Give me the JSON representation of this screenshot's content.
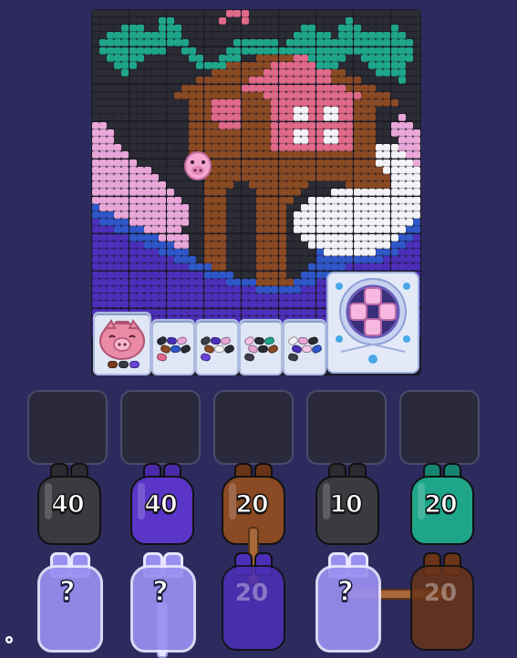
{
  "game": {
    "palette": {
      "K": "#2b2b34",
      "k": "#3d3d49",
      "T": "#1fa68a",
      "t": "#2cc2a2",
      "P": "#e8a7d8",
      "p": "#f6c4ea",
      "B": "#8a4a24",
      "b": "#a85e2e",
      "R": "#e06a8a",
      "W": "#f3f3f7",
      "V": "#4c2fb8",
      "v": "#6a45d8",
      "U": "#2f57c8",
      "D": "#3a2a1f"
    },
    "mosaic_rows": [
      "KKKKKKKKKKKKKKKKKKRRRKKKKKKKKKKKKKKKKKKKKKKK",
      "KKKKKKKKKTTKKKKKKRKKRKKKKKKKKKKKKKTKKKKKKKKK",
      "KKKKTTTKKTTTKKKKKKKKKKKKKKKKTTKKKTTTKKKKTKKK",
      "KKTTTTTTTTTTKKKKKKKKKKKKKKKTTTTTKTTTTTTTTTKK",
      "KTTTTTTTTTTTTKKKKKKTTTTTTKTTTTTTTTTTTTTTTTTK",
      "KTTTTTTTTTKKTTKKKKTTTTTTTTTTTTTTTTTTTTTTTTTK",
      "KKTTTTTKKKKKKTTKKTTTKKBBBBBRRTTTTTKKTTTTTTTK",
      "KKKTTTKKKKKKKKTTTTBBBBBBRRRRRRTTTKKKKTTTTTKK",
      "KKKKTKKKKKKKKKKKBBBBBBBRRRRRRRRRBBKKKKTTTTKK",
      "KKKKKKKKKKKKKKBBBBBBBRRRRRRRRRRRBBBBKKKKKTKK",
      "KKKKKKKKKKKKBBBBBBBBRRRRRRRRRRRRRRBBBBKKKKKK",
      "KKKKKKKKKKKBBBBBBBBBBBBRRRRRRRRRRRRRBBBBKKKK",
      "KKKKKKKKKKKKKBBBRRRRBBBBRRRRRRRRRRRBBBBBBKKK",
      "KKKKKKKKKKKKKBBBRRRRBBBBRRRWWRRWWRRBBBKKKKKK",
      "KKKKKKKKKKKKKBBBRRRRBBBBRRRWWRRWWRRBBBKKKPKK",
      "PPKKKKKKKKKKKBBBBRRRBBBBRRRRRRRRRRRBBBKKPPPK",
      "PPPKKKKKKKKKKBBBBBBBBBBBRRRWWRRWWRRBBBKKPPPP",
      "PPPKKKKKKKKKKBBBBBBBBBBBRRRWWRRWWRRBBBKKKPPP",
      "PPPPKKKKKKKKKBBBBBBBBBBBRRRRRRRRRRRBBBWWWPPP",
      "PPPPPKKKKKKKKBBBBBBBBBBBBBBBBBBBBBBBBBWWWWPP",
      "PPPPPPKKKKKKKKBBBBBBBBBBBBBBBBBBBBBBBBWWWWWP",
      "PPPPPPPPKKKKKKKBBBBBBBBBBBBBBBBBBBBBBBBWWWWW",
      "PPPPPPPPPKKKKKKBBBBBBBBBBBBBBBBBBBBBBBBBWWWW",
      "PPPPPPPPPPKKKKKBBBBKKBBBBBBBBKKKKKBBBBBBWWWW",
      "PPPPPPPPPPPKKKKBBBKKKKBBBBBBKKKKWWWWWWWWWWWW",
      "PPPPPPPPPPPPKKKBBBKKKKBBBBBKKWWWWWWWWWWWWWWW",
      "UPPPPPPPPPPPPKKBBBKKKKBBBBKKWWWWWWWWWWWWWWWW",
      "UUUPPPPPPPPPPKKBBBKKKKBBBBKWWWWWWWWWWWWWWWWW",
      "VUUUUPPPPPPPPKKBBBKKKKBBBBKWWWWWWWWWWWWWWWWU",
      "VVVUUUUPPPPPKKKBBBKKKKBBBBKWWWWWWWWWWWWWWWUU",
      "VVVVVUUUUPPPPKKBBBKKKKBBBBKKWWWWWWWWWWWWWUUV",
      "VVVVVVVUUUUPPKKBBBKKKKBBBBKKKWWWWWWWWWWWUUVV",
      "VVVVVVVVVUUUUKKBBBKKKKBBBBKKKKUWWWWWWWUUUVVV",
      "VVVVVVVVVVVUUUKBBBKKKKBBBBKKKKUUUUUUUUUVVVVV",
      "VVVVVVVVVVVVVUUUBBKKKKBBBBKKKUUUUUVVVVVVVVVV",
      "VVVVVVVVVVVVVVVUUUUKKKBBBBKKUUUUVVVVVVVVVVVV",
      "VVVVVVVVVVVVVVVVVVUUUUBBBBBUUUVVVVVVVVVVVVVV",
      "VVVVVVVVVVVVVVVVVVVVVVUUUUUUVVVVVVVVVVVVVVVV",
      "VVVVVVVVVVVVVVVVVVVVVVVVVVVVVVVVVVVVVVVVVVVV",
      "VVVVVVVVVVVVVVVVVVVVVVVVVVVVVVVVVVVVVVVVVVVV",
      "VVVVVVVVVVVVVVVVVVVVVVVVVVVVVVVVVVVVVVVVVVVV",
      "VVVVVVVVVVVVVVVVVVVVVVVVVVVVVVVVVVVVVVVVVVVV",
      "VVVVVVVVVVVVVVVVVVVVVVVVVVVVVVVVVVVVVVVVVVVV",
      "VVVVVVVVVVVVVVVVVVVVVVVVVVVVVVVVVVVVVVVVVVVV"
    ],
    "trays": [
      {
        "name": "piggy-bank-tray",
        "beans": [
          "#7a3a20",
          "#3a3a44",
          "#6a45d8"
        ]
      },
      {
        "name": "bean-tray-1",
        "beans": [
          "#2b2b34",
          "#4c2fb8",
          "#e8a7d8",
          "#8a4a24",
          "#2f57c8",
          "#2b2b34",
          "#e06a8a"
        ]
      },
      {
        "name": "bean-tray-2",
        "beans": [
          "#3d3d49",
          "#4c2fb8",
          "#e8a7d8",
          "#8a4a24",
          "#f3f3f7",
          "#2b2b34",
          "#6a45d8"
        ]
      },
      {
        "name": "bean-tray-3",
        "beans": [
          "#f6c4ea",
          "#2b2b34",
          "#1fa68a",
          "#e8a7d8",
          "#2b2b34",
          "#8a4a24",
          "#3d3d49"
        ]
      },
      {
        "name": "bean-tray-4",
        "beans": [
          "#f3f3f7",
          "#e8a7d8",
          "#2b2b34",
          "#4c2fb8",
          "#f6c4ea",
          "#2f57c8",
          "#3d3d49"
        ]
      }
    ],
    "active_bottles": [
      {
        "color": "#3a3a40",
        "ear": "#2b2b30",
        "count": "40"
      },
      {
        "color": "#5a35c8",
        "ear": "#4a2aa8",
        "count": "40"
      },
      {
        "color": "#8a4a24",
        "ear": "#6a3418",
        "count": "20"
      },
      {
        "color": "#3a3a40",
        "ear": "#2b2b30",
        "count": "10"
      },
      {
        "color": "#1fa68a",
        "ear": "#168470",
        "count": "20"
      }
    ],
    "queued_bottles": [
      {
        "type": "mystery",
        "label": "?",
        "color": "#9a8ef0"
      },
      {
        "type": "mystery",
        "label": "?",
        "color": "#9a8ef0"
      },
      {
        "type": "hidden",
        "label": "20",
        "color": "#4c2fb8"
      },
      {
        "type": "mystery",
        "label": "?",
        "color": "#9a8ef0"
      },
      {
        "type": "hidden",
        "label": "20",
        "color": "#6a3418"
      }
    ]
  }
}
